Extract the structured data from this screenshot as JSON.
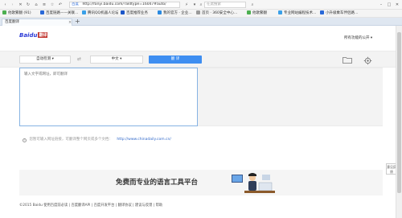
{
  "browser": {
    "url": "http://fanyi.baidu.com/?aldtype=16047#auto/",
    "url_prefix": "百度",
    "search_placeholder": "在此搜索",
    "bookmarks": [
      {
        "label": "他歌繁翻 (91)",
        "color": "#4caf50"
      },
      {
        "label": "百度链路——关联…",
        "color": "#2a69d8"
      },
      {
        "label": "腾讯QQ机器人论坛…",
        "color": "#3aa0e8"
      },
      {
        "label": "百度推荐业务",
        "color": "#1c56c8"
      },
      {
        "label": "我的官方 · 企业…",
        "color": "#2b8ae0"
      },
      {
        "label": "首页 · 360安全中心…",
        "color": "#9a9a9a"
      },
      {
        "label": "他歌繁翻",
        "color": "#4caf50"
      },
      {
        "label": "专业网站编程技术…",
        "color": "#3aa0e8"
      },
      {
        "label": "小升级乘车伴侣路…",
        "color": "#2a69d8"
      }
    ],
    "tab_title": "百度翻译",
    "tab_close": "×",
    "new_tab": "+"
  },
  "header": {
    "logo_text": "Bai",
    "logo_suffix": "du",
    "logo_fanyi": "翻译",
    "right_link": "所有功能的公开 ▾"
  },
  "toolbar": {
    "source_lang": "自动检测 ▾",
    "swap_icon": "⇄",
    "target_lang": "中文 ▾",
    "translate_label": "翻 译"
  },
  "input": {
    "placeholder": "输入文字或网址，即可翻译"
  },
  "hint": {
    "text": "您暂可输入网址链接，可翻译整个网页或多个文档：",
    "link": "http://www.chinadaily.com.cn/"
  },
  "feedback": {
    "label": "意见反馈"
  },
  "banner": {
    "text": "免费而专业的语言工具平台"
  },
  "footer": {
    "text": "©2015 Baidu  使用百度前必读  |  百度翻译API  |  百度开发平台  |  翻译协议  |  建议与反馈  |  帮助"
  }
}
